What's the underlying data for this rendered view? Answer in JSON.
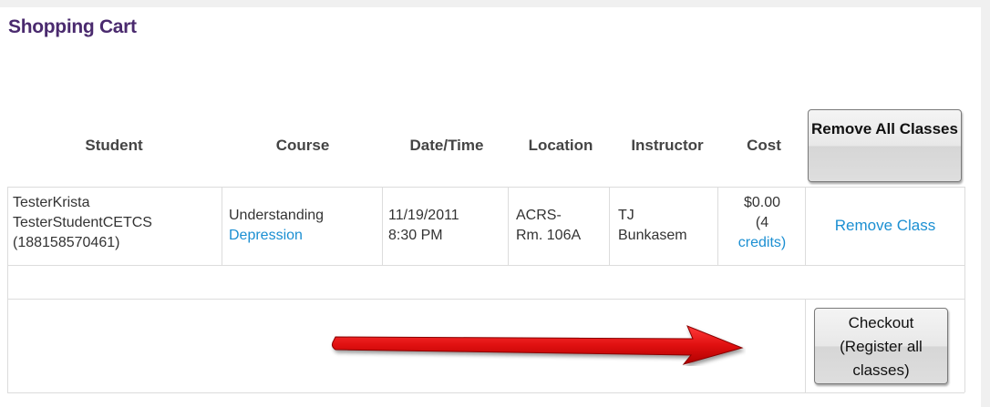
{
  "page": {
    "title": "Shopping Cart"
  },
  "table": {
    "headers": [
      "Student",
      "Course",
      "Date/Time",
      "Location",
      "Instructor",
      "Cost"
    ],
    "remove_all_label": "Remove All Classes",
    "row": {
      "student_first": "TesterKrista",
      "student_last": "TesterStudentCETCS",
      "student_id": "(188158570461)",
      "course_line1": "Understanding",
      "course_line2": "Depression",
      "date": "11/19/2011",
      "time": "8:30 PM",
      "location_line1": "ACRS-",
      "location_line2": "Rm. 106A",
      "instructor_line1": "TJ",
      "instructor_line2": "Bunkasem",
      "cost": "$0.00",
      "credits_open": "(4",
      "credits_close": "credits)",
      "remove_label": "Remove Class"
    }
  },
  "checkout": {
    "label": "Checkout (Register all classes)"
  },
  "colors": {
    "title": "#4a2a6e",
    "link": "#1b8fd2",
    "arrow": "#e01010"
  },
  "icons": {
    "arrow": "right-arrow-annotation-icon"
  }
}
